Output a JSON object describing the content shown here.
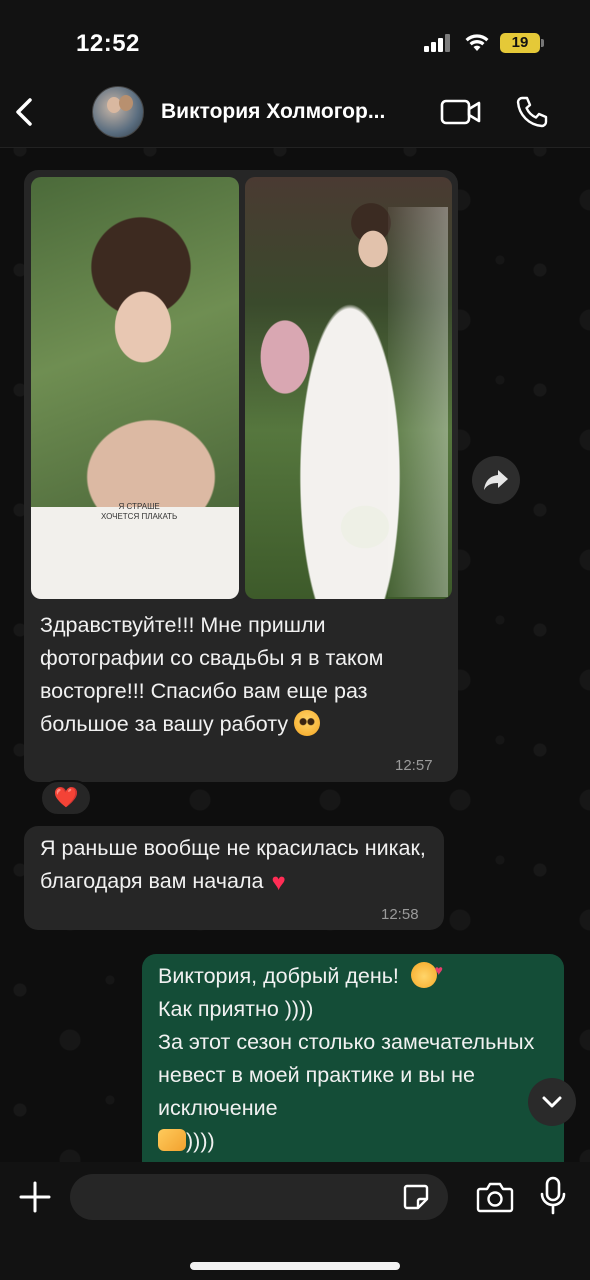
{
  "status_bar": {
    "time": "12:52",
    "battery": "19",
    "battery_color": "#e5c938"
  },
  "header": {
    "contact_name": "Виктория Холмогор...",
    "back_icon": "chevron-left-icon",
    "video_icon": "video-camera-icon",
    "call_icon": "phone-icon"
  },
  "messages": [
    {
      "direction": "incoming",
      "type": "photos+text",
      "text": "Здравствуйте!!! Мне пришли фотографии со свадьбы я в таком восторге!!! Спасибо вам еще раз большое за вашу работу",
      "emoji": "pleading-face",
      "time": "12:57",
      "reaction": "❤️",
      "photo_overlay_text": "Я СТРАШЕ\nХОЧЕТСЯ ПЛАКАТЬ"
    },
    {
      "direction": "incoming",
      "type": "text",
      "text": "Я раньше вообще не красилась никак, благодаря вам начала",
      "emoji": "heart-with-arrow",
      "time": "12:58"
    },
    {
      "direction": "outgoing",
      "type": "text",
      "line1": "Виктория, добрый день!",
      "line1_emoji": "smiling-face-with-hearts",
      "line2": "Как приятно ))))",
      "line3": "За этот сезон столько замечательных невест в моей практике и вы не исключение",
      "line4_emoji": "heart-hands",
      "line4": "))))"
    }
  ],
  "input": {
    "placeholder": "",
    "plus_icon": "plus-icon",
    "sticker_icon": "sticker-icon",
    "camera_icon": "camera-icon",
    "mic_icon": "microphone-icon"
  },
  "colors": {
    "incoming_bubble": "#262626",
    "outgoing_bubble": "#144d37",
    "background": "#0e0e0e"
  }
}
